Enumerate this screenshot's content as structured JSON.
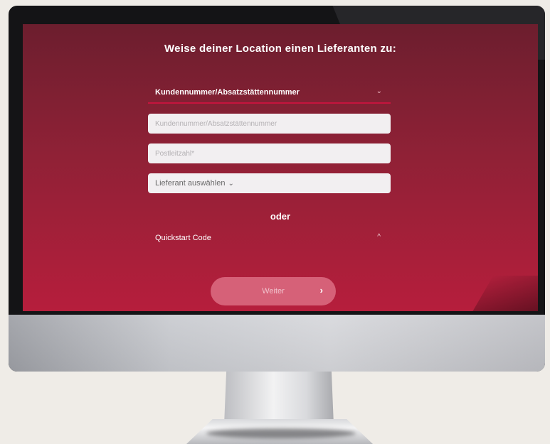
{
  "screen": {
    "title": "Weise deiner Location einen Lieferanten zu:",
    "id_type_select": {
      "label": "Kundennummer/Absatzstättennummer",
      "chevron": "chevron-down-icon"
    },
    "customer_number_input": {
      "placeholder": "Kundennummer/Absatzstättennummer",
      "value": ""
    },
    "postal_code_input": {
      "placeholder": "Postleitzahl*",
      "value": ""
    },
    "supplier_dropdown": {
      "label": "Lieferant auswählen",
      "chevron": "⌄"
    },
    "separator": "oder",
    "quickstart": {
      "label": "Quickstart Code",
      "chevron": "^"
    },
    "continue_button": {
      "label": "Weiter",
      "chevron": "›"
    }
  },
  "colors": {
    "gradient_top": "#6c1e2e",
    "gradient_bottom": "#b61e3c",
    "accent_line": "#c5143e",
    "button": "#d66178"
  }
}
